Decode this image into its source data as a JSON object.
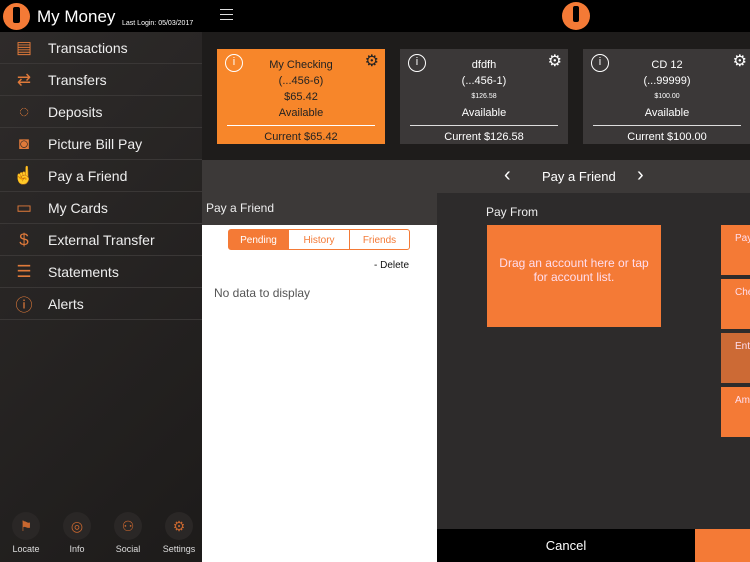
{
  "header": {
    "app_title": "My Money",
    "last_login": "Last Login: 05/03/2017"
  },
  "sidebar": {
    "items": [
      {
        "label": "Transactions",
        "icon": "money-icon"
      },
      {
        "label": "Transfers",
        "icon": "transfer-arrows-icon"
      },
      {
        "label": "Deposits",
        "icon": "piggy-bank-icon"
      },
      {
        "label": "Picture Bill Pay",
        "icon": "camera-icon"
      },
      {
        "label": "Pay a Friend",
        "icon": "hand-coin-icon"
      },
      {
        "label": "My Cards",
        "icon": "cards-icon"
      },
      {
        "label": "External Transfer",
        "icon": "dollar-cycle-icon"
      },
      {
        "label": "Statements",
        "icon": "statement-icon"
      },
      {
        "label": "Alerts",
        "icon": "alert-icon"
      }
    ],
    "footer": [
      {
        "label": "Locate"
      },
      {
        "label": "Info"
      },
      {
        "label": "Social"
      },
      {
        "label": "Settings"
      }
    ]
  },
  "accounts": [
    {
      "name": "My Checking",
      "number": "(...456-6)",
      "balance": "$65.42",
      "available": "Available",
      "current": "Current $65.42",
      "selected": true
    },
    {
      "name": "dfdfh",
      "number": "(...456-1)",
      "balance": "$126.58",
      "available": "Available",
      "current": "Current $126.58"
    },
    {
      "name": "CD 12",
      "number": "(...99999)",
      "balance": "$100.00",
      "available": "Available",
      "current": "Current $100.00"
    }
  ],
  "nav": {
    "title": "Pay a Friend"
  },
  "left_panel": {
    "title": "Pay a Friend",
    "tabs": [
      "Pending",
      "History",
      "Friends"
    ],
    "active_tab": "Pending",
    "delete": "- Delete",
    "empty": "No data to display"
  },
  "right_panel": {
    "pay_from": "Pay From",
    "drop_hint": "Drag an account here or tap for account list.",
    "fields": [
      "Pay",
      "Che",
      "Ent",
      "Am"
    ]
  },
  "bottom": {
    "cancel": "Cancel"
  },
  "colors": {
    "accent": "#f47a36",
    "card_orange": "#f7862a",
    "dark": "#3b3838"
  }
}
